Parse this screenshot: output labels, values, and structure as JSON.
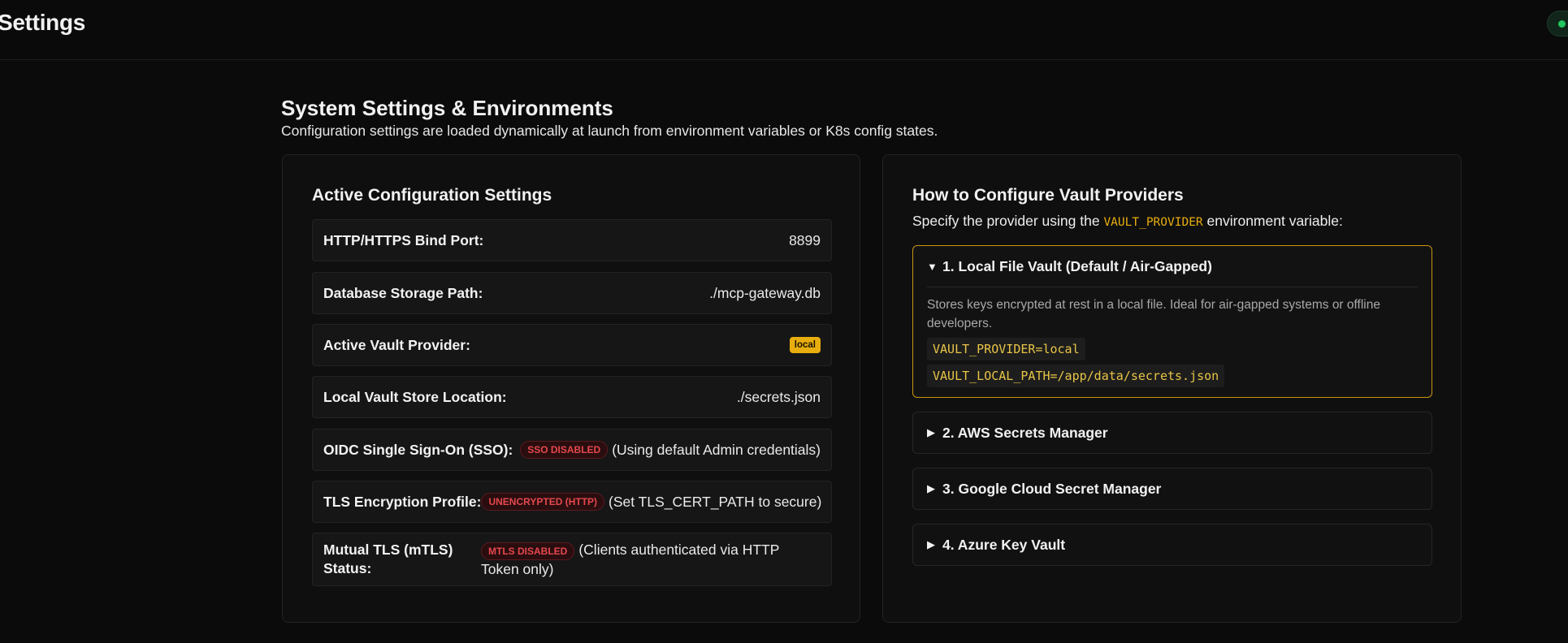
{
  "topbar": {
    "title": "Settings",
    "status_color": "#22c55e"
  },
  "page": {
    "heading": "System Settings & Environments",
    "subheading": "Configuration settings are loaded dynamically at launch from environment variables or K8s config states."
  },
  "active": {
    "title": "Active Configuration Settings",
    "rows": [
      {
        "label": "HTTP/HTTPS Bind Port:",
        "value": "8899"
      },
      {
        "label": "Database Storage Path:",
        "value": "./mcp-gateway.db"
      },
      {
        "label": "Active Vault Provider:",
        "badge": "local"
      },
      {
        "label": "Local Vault Store Location:",
        "value": "./secrets.json"
      },
      {
        "label": "OIDC Single Sign-On (SSO):",
        "badge": "SSO DISABLED",
        "value": "(Using default Admin credentials)"
      },
      {
        "label": "TLS Encryption Profile:",
        "badge": "UNENCRYPTED (HTTP)",
        "value": "(Set TLS_CERT_PATH to secure)"
      },
      {
        "label": "Mutual TLS (mTLS) Status:",
        "badge": "MTLS DISABLED",
        "value": "(Clients authenticated via HTTP Token only)"
      }
    ]
  },
  "vault": {
    "title": "How to Configure Vault Providers",
    "sub_prefix": "Specify the provider using the",
    "sub_code": "VAULT_PROVIDER",
    "sub_suffix": "environment variable:",
    "providers": [
      {
        "label": "1. Local File Vault (Default / Air-Gapped)",
        "expanded": true,
        "caret": "▼",
        "description": "Stores keys encrypted at rest in a local file. Ideal for air-gapped systems or offline developers.",
        "env": [
          "VAULT_PROVIDER=local",
          "VAULT_LOCAL_PATH=/app/data/secrets.json"
        ]
      },
      {
        "label": "2. AWS Secrets Manager",
        "expanded": false,
        "caret": "▶"
      },
      {
        "label": "3. Google Cloud Secret Manager",
        "expanded": false,
        "caret": "▶"
      },
      {
        "label": "4. Azure Key Vault",
        "expanded": false,
        "caret": "▶"
      }
    ]
  }
}
